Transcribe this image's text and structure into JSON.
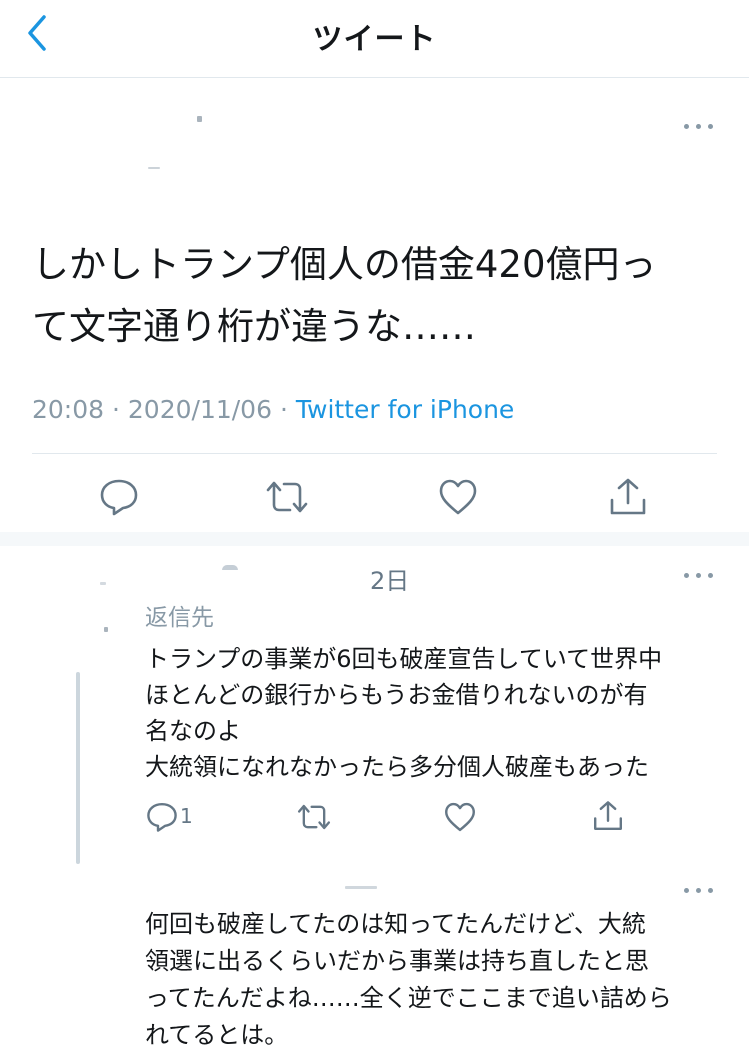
{
  "header": {
    "title": "ツイート",
    "back_icon": "chevron-left-icon"
  },
  "tweet": {
    "text_line1": "しかしトランプ個人の借金420億円っ",
    "text_line2": "て文字通り桁が違うな……",
    "time": "20:08",
    "sep": "·",
    "date": "2020/11/06",
    "source": "Twitter for iPhone",
    "actions": [
      "reply-icon",
      "retweet-icon",
      "like-icon",
      "share-icon"
    ]
  },
  "reply1": {
    "time": "2日",
    "replying_to": "返信先",
    "lines": [
      "トランプの事業が6回も破産宣告していて世界中",
      "ほとんどの銀行からもうお金借りれないのが有",
      "名なのよ",
      "大統領になれなかったら多分個人破産もあった"
    ],
    "reply_count": "1"
  },
  "reply2": {
    "lines": [
      "何回も破産してたのは知ってたんだけど、大統",
      "領選に出るくらいだから事業は持ち直したと思",
      "ってたんだよね……全く逆でここまで追い詰めら",
      "れてるとは。"
    ]
  },
  "colors": {
    "link": "#1b95e0",
    "muted": "#8899a6",
    "icon": "#657786",
    "divider": "#e1e8ed"
  }
}
